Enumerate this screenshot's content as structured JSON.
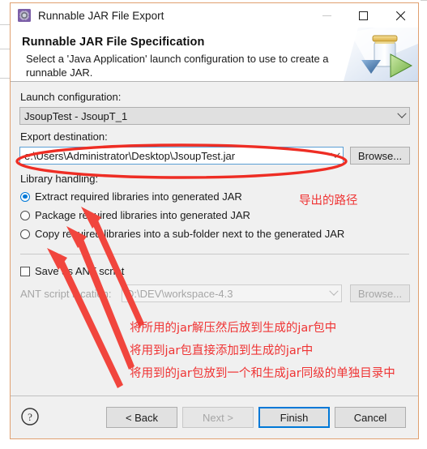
{
  "window": {
    "title": "Runnable JAR File Export",
    "title_icon": "gear-export-icon",
    "controls": {
      "minimize": "minimize-icon",
      "maximize": "maximize-icon",
      "close": "close-icon"
    }
  },
  "header": {
    "title": "Runnable JAR File Specification",
    "description": "Select a 'Java Application' launch configuration to use to create a runnable JAR.",
    "graphic": "jar-export-icon"
  },
  "form": {
    "launch_configuration": {
      "label": "Launch configuration:",
      "value": "JsoupTest - JsoupT_1"
    },
    "export_destination": {
      "label": "Export destination:",
      "value": "e:\\Users\\Administrator\\Desktop\\JsoupTest.jar",
      "browse_label": "Browse..."
    },
    "library_handling": {
      "label": "Library handling:",
      "options": [
        {
          "label": "Extract required libraries into generated JAR",
          "selected": true
        },
        {
          "label": "Package required libraries into generated JAR",
          "selected": false
        },
        {
          "label": "Copy required libraries into a sub-folder next to the generated JAR",
          "selected": false
        }
      ]
    },
    "save_as_ant": {
      "label": "Save as ANT script",
      "checked": false
    },
    "ant_script_location": {
      "label": "ANT script location:",
      "value": "D:\\DEV\\workspace-4.3",
      "browse_label": "Browse...",
      "disabled": true
    }
  },
  "footer": {
    "help_icon": "help-icon",
    "buttons": [
      {
        "name": "back",
        "label": "< Back",
        "disabled": false,
        "default": false
      },
      {
        "name": "next",
        "label": "Next >",
        "disabled": true,
        "default": false
      },
      {
        "name": "finish",
        "label": "Finish",
        "disabled": false,
        "default": true
      },
      {
        "name": "cancel",
        "label": "Cancel",
        "disabled": false,
        "default": false
      }
    ]
  },
  "annotations": {
    "color": "#ef3434",
    "ellipse_target": "export-destination-combo",
    "notes": [
      {
        "id": "note-export-path",
        "text": "导出的路径"
      },
      {
        "id": "note-extract",
        "text": "将所用的jar解压然后放到生成的jar包中"
      },
      {
        "id": "note-package",
        "text": "将用到jar包直接添加到生成的jar中"
      },
      {
        "id": "note-copy",
        "text": "将用到的jar包放到一个和生成jar同级的单独目录中"
      }
    ]
  }
}
